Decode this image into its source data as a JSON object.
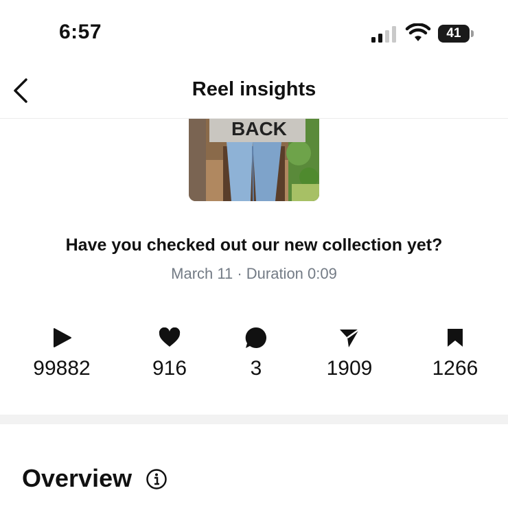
{
  "status_bar": {
    "time": "6:57",
    "battery_level": "41"
  },
  "header": {
    "title": "Reel insights",
    "back_icon": "chevron-left-icon"
  },
  "thumbnail": {
    "text": "BACK"
  },
  "reel": {
    "caption": "Have you checked out our new collection yet?",
    "meta": "March 11 · Duration 0:09"
  },
  "stats": [
    {
      "icon": "play-icon",
      "value": "99882"
    },
    {
      "icon": "heart-icon",
      "value": "916"
    },
    {
      "icon": "comment-icon",
      "value": "3"
    },
    {
      "icon": "send-icon",
      "value": "1909"
    },
    {
      "icon": "bookmark-icon",
      "value": "1266"
    }
  ],
  "overview": {
    "title": "Overview",
    "icon": "info-icon"
  }
}
